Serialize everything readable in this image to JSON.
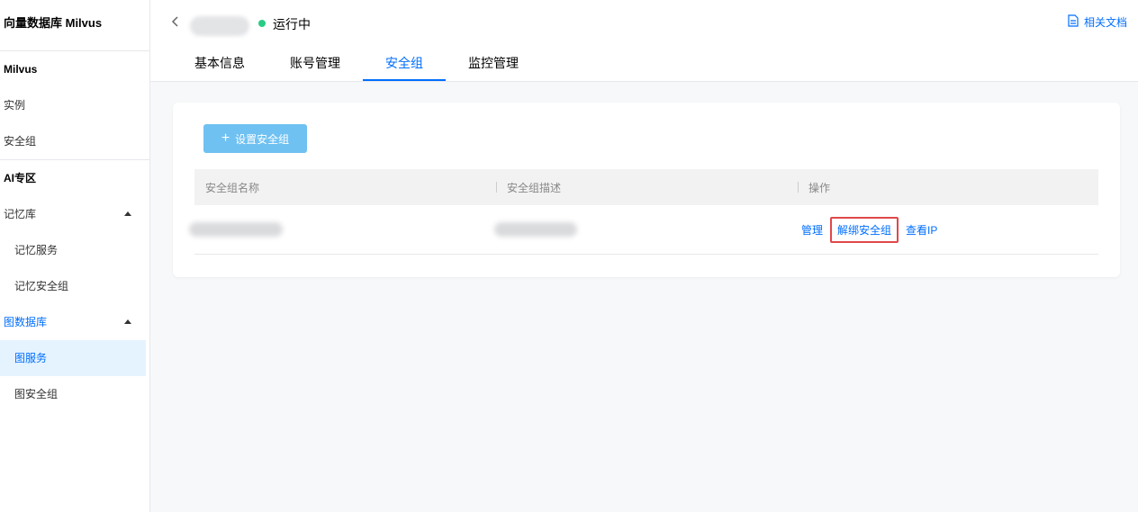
{
  "sidebar": {
    "product_title": "向量数据库 Milvus",
    "groups": [
      {
        "title": "Milvus",
        "items": [
          {
            "label": "实例"
          },
          {
            "label": "安全组"
          }
        ]
      },
      {
        "title": "AI专区"
      }
    ],
    "memory": {
      "label": "记忆库",
      "children": [
        {
          "label": "记忆服务"
        },
        {
          "label": "记忆安全组"
        }
      ]
    },
    "graph": {
      "label": "图数据库",
      "children": [
        {
          "label": "图服务"
        },
        {
          "label": "图安全组"
        }
      ]
    }
  },
  "header": {
    "status": "运行中",
    "docs": "相关文档",
    "tabs": [
      {
        "label": "基本信息"
      },
      {
        "label": "账号管理"
      },
      {
        "label": "安全组"
      },
      {
        "label": "监控管理"
      }
    ]
  },
  "content": {
    "set_sg_button": "设置安全组",
    "table": {
      "headers": [
        "安全组名称",
        "安全组描述",
        "操作"
      ],
      "row_actions": [
        "管理",
        "解绑安全组",
        "查看IP"
      ]
    }
  },
  "colors": {
    "accent": "#006eff",
    "status": "#29cc85",
    "highlight": "#e0484a"
  }
}
